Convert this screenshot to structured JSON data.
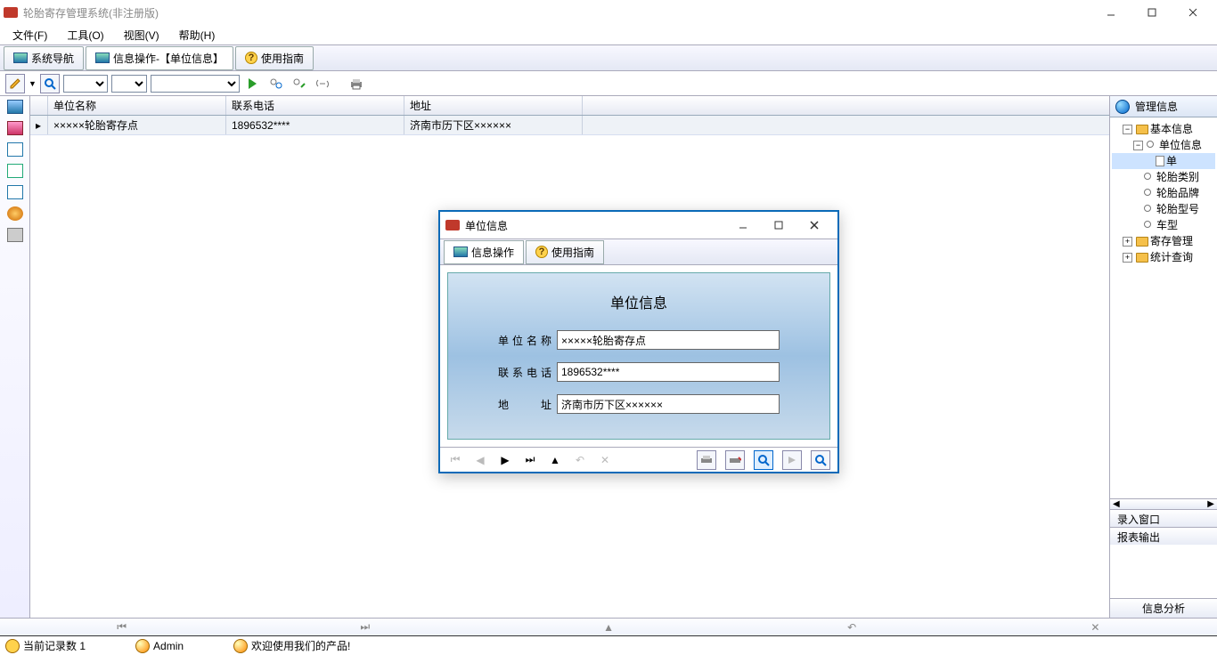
{
  "titlebar": {
    "title": "轮胎寄存管理系统(非注册版)"
  },
  "menu": {
    "file": "文件(F)",
    "tool": "工具(O)",
    "view": "视图(V)",
    "help": "帮助(H)"
  },
  "tabs": {
    "nav": "系统导航",
    "info": "信息操作-【单位信息】",
    "guide": "使用指南"
  },
  "grid": {
    "headers": {
      "name": "单位名称",
      "phone": "联系电话",
      "addr": "地址"
    },
    "row": {
      "name": "×××××轮胎寄存点",
      "phone": "1896532****",
      "addr": "济南市历下区××××××"
    }
  },
  "rightPanel": {
    "title": "管理信息",
    "tree": {
      "basic": "基本信息",
      "unit": "单位信息",
      "unitSub": "单",
      "tireType": "轮胎类别",
      "tireBrand": "轮胎品牌",
      "tireModel": "轮胎型号",
      "carType": "车型",
      "store": "寄存管理",
      "stat": "统计查询"
    },
    "sections": {
      "input": "录入窗口",
      "report": "报表输出"
    },
    "footer": "信息分析"
  },
  "dialog": {
    "title": "单位信息",
    "tabInfo": "信息操作",
    "tabGuide": "使用指南",
    "formTitle": "单位信息",
    "labels": {
      "name": "单位名称",
      "phone": "联系电话",
      "addr": "地　　址"
    },
    "values": {
      "name": "×××××轮胎寄存点",
      "phone": "1896532****",
      "addr": "济南市历下区××××××"
    }
  },
  "status": {
    "records": "当前记录数  1",
    "user": "Admin",
    "welcome": "欢迎使用我们的产品!"
  }
}
